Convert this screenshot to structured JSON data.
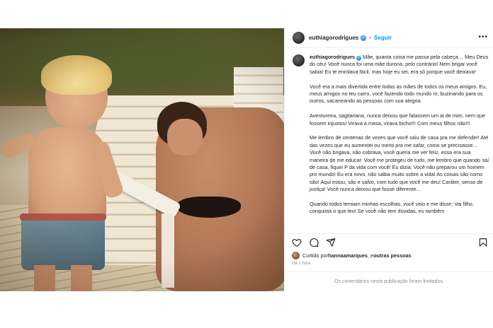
{
  "header": {
    "username": "euthiagorodrigues",
    "verified_mark": "✔",
    "separator": "•",
    "follow_label": "Seguir",
    "more_icon": "more-horizontal-icon"
  },
  "caption": {
    "username": "euthiagorodrigues",
    "verified_mark": "✔",
    "paragraphs": [
      "Mãe, quanta coisa me passa pela cabeça… Meu Deus do céu! Você nunca foi uma mãe durona, pelo contrário! Nem brigar você sabia! Eu te enrolava fácil, mas hoje eu sei, era só porque você deixava!",
      "Você era a mais divertida entre todas as mães de todos os meus amigos. Eu, meus amigos no teu carro, você fazendo todo mundo rir, buzinando para os outros, sacaneando as pessoas com sua alegria.",
      "Aventureira, sagitariana, nunca deixou que falassem um ai de mim, nem que fossem injustos! Virava a mesa, virava bicho!!! Com meus filhos não!!!",
      "Me lembro de centenas de vezes que você saiu de casa pra me defender! Até das vezes que eu aumentei ou menti pra me safar, como se precisasse… Você não brigava, não cobrava, você queria me ver feliz, essa era sua maneira de me educar. Você me protegeu de tudo, me lembro que quando saí de casa, fiquei P da vida com você! Eu dizia: Você não preparou um homem pro mundo! Eu era novo, não sabia muito sobre a vida! As coisas são como são! Aqui estou, são e salvo, com tudo que você me deu! Caráter, senso de justiça! Você nunca deixou que fosse diferente…",
      "Quando todos temiam minhas escolhas, você veio e me disse: Vai filho, conquista o que teu! Se você não tem dúvidas, eu também"
    ]
  },
  "actions": {
    "like_icon": "heart-icon",
    "comment_icon": "comment-icon",
    "share_icon": "share-icon",
    "save_icon": "bookmark-icon"
  },
  "likes": {
    "prefix": "Curtido por ",
    "user": "hannaamarques_",
    "middle": " e ",
    "others": "outras pessoas"
  },
  "timestamp": "Há 1 hora",
  "comments_notice": "Os comentários nesta publicação foram limitados."
}
